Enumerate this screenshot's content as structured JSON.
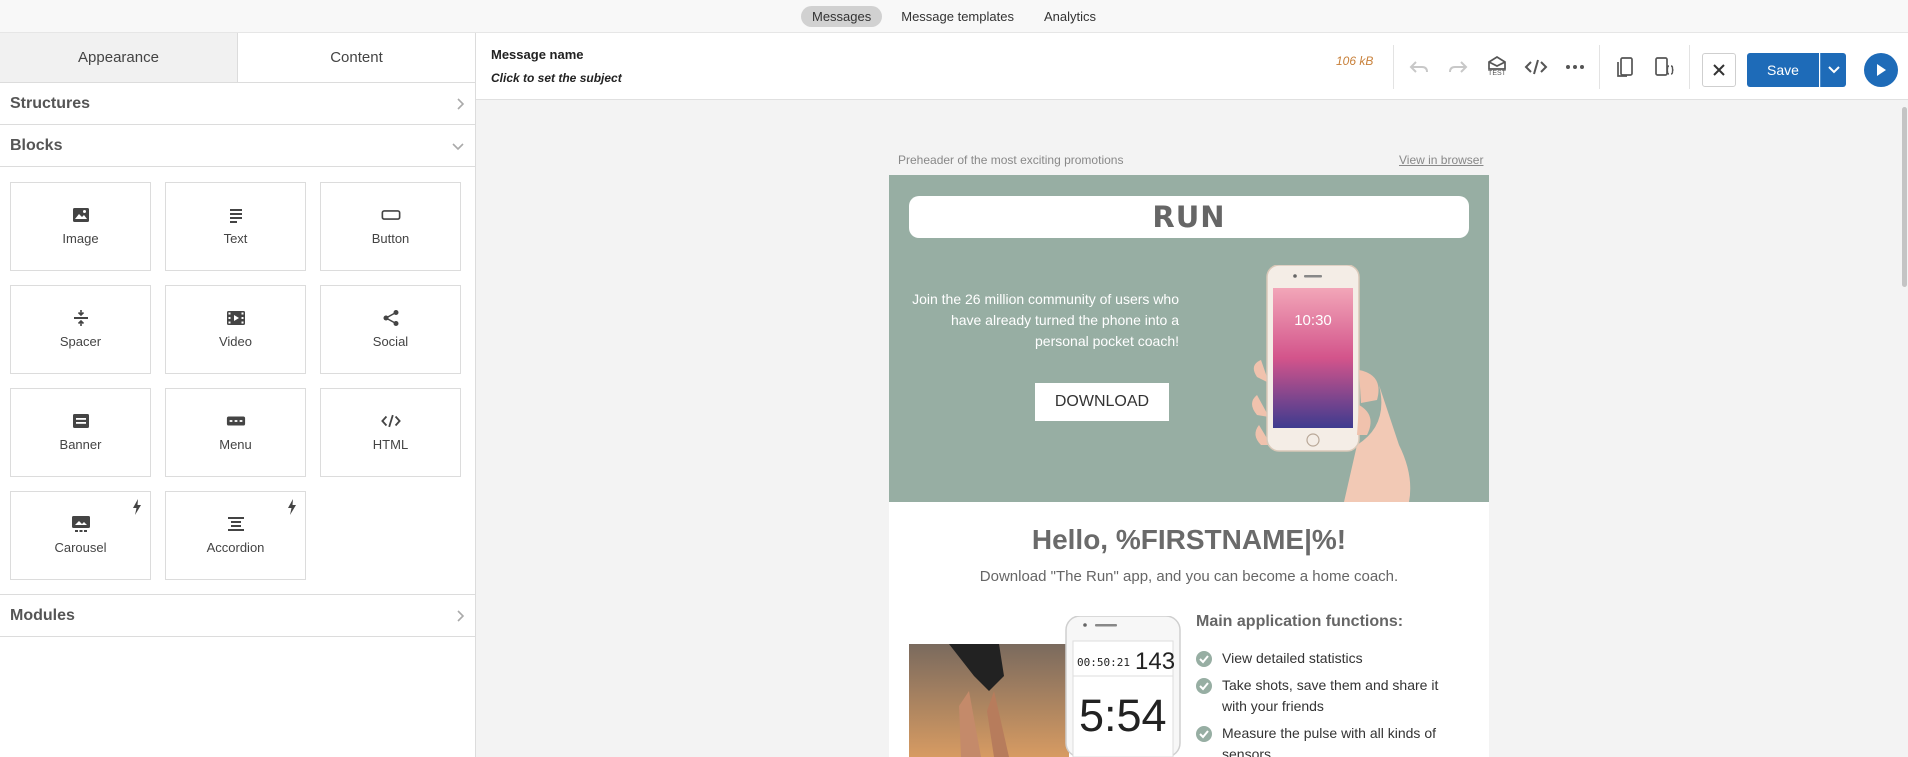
{
  "topnav": {
    "tabs": [
      {
        "label": "Messages",
        "active": true
      },
      {
        "label": "Message templates",
        "active": false
      },
      {
        "label": "Analytics",
        "active": false
      }
    ]
  },
  "leftpanel": {
    "tabs": [
      {
        "label": "Appearance",
        "active": false
      },
      {
        "label": "Content",
        "active": true
      }
    ],
    "sections": {
      "structures": "Structures",
      "blocks": "Blocks",
      "modules": "Modules"
    },
    "blocks": [
      {
        "label": "Image",
        "icon": "image-icon"
      },
      {
        "label": "Text",
        "icon": "text-icon"
      },
      {
        "label": "Button",
        "icon": "button-icon"
      },
      {
        "label": "Spacer",
        "icon": "spacer-icon"
      },
      {
        "label": "Video",
        "icon": "video-icon"
      },
      {
        "label": "Social",
        "icon": "share-icon"
      },
      {
        "label": "Banner",
        "icon": "banner-icon"
      },
      {
        "label": "Menu",
        "icon": "menu-icon"
      },
      {
        "label": "HTML",
        "icon": "code-icon"
      },
      {
        "label": "Carousel",
        "icon": "carousel-icon",
        "amp": true
      },
      {
        "label": "Accordion",
        "icon": "accordion-icon",
        "amp": true
      }
    ]
  },
  "toolbar": {
    "message_name": "Message name",
    "subject_placeholder": "Click to set the subject",
    "size": "106 kB",
    "test_label": "TEST",
    "save_label": "Save",
    "accent": "#1e6bb8"
  },
  "email": {
    "preheader": "Preheader of the most exciting promotions",
    "view_in_browser": "View in browser",
    "logo_text": "RUN",
    "hero_text": "Join the 26 million community of users who have already turned the phone into a personal pocket coach!",
    "download_label": "DOWNLOAD",
    "phone_time": "10:30",
    "greeting": "Hello, %FIRSTNAME|%!",
    "subtitle": "Download \"The Run\" app, and you can become a home coach.",
    "functions_title": "Main application functions:",
    "functions": [
      "View detailed statistics",
      "Take shots, save them and share it with your friends",
      "Measure the pulse with all kinds of sensors"
    ],
    "stats": {
      "timer": "00:50:21",
      "count": "143",
      "pace": "5:54"
    },
    "hero_bg": "#97aea3"
  }
}
